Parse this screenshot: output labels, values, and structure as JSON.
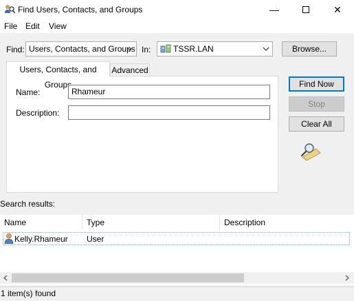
{
  "window": {
    "title": "Find Users, Contacts, and Groups",
    "minimize_glyph": "—",
    "maximize_glyph": "☐",
    "close_glyph": "✕"
  },
  "menu": [
    "File",
    "Edit",
    "View"
  ],
  "find_row": {
    "find_label": "Find:",
    "find_value": "Users, Contacts, and Groups",
    "in_label": "In:",
    "in_value": "TSSR.LAN",
    "browse_label": "Browse..."
  },
  "tabs": [
    {
      "label": "Users, Contacts, and Groups",
      "active": true
    },
    {
      "label": "Advanced",
      "active": false
    }
  ],
  "form": {
    "name_label": "Name:",
    "name_value": "Rhameur",
    "description_label": "Description:",
    "description_value": ""
  },
  "buttons": {
    "find_now": "Find Now",
    "stop": "Stop",
    "clear_all": "Clear All"
  },
  "results": {
    "label": "Search results:",
    "columns": [
      "Name",
      "Type",
      "Description"
    ],
    "rows": [
      {
        "name": "Kelly.Rhameur",
        "type": "User",
        "description": ""
      }
    ]
  },
  "status": "1 item(s) found",
  "colors": {
    "accent": "#0078d7",
    "selection_border": "#7da2ce"
  },
  "icons": {
    "app": "find-users-icon",
    "domain": "domain-icon",
    "search_animation": "magnifier-icon",
    "user": "user-icon"
  }
}
